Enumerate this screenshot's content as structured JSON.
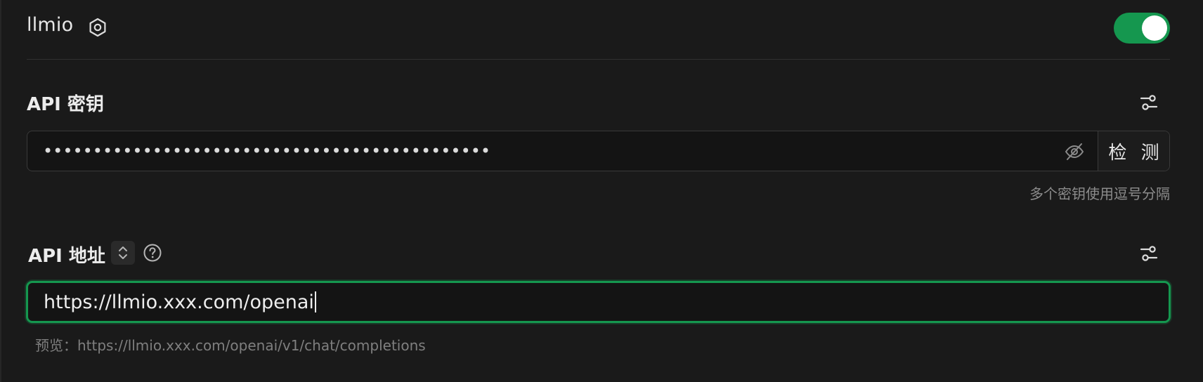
{
  "provider": {
    "name": "llmio",
    "enabled": true,
    "accent_color": "#15974f"
  },
  "icons": {
    "provider_settings": "hexagon-settings-icon",
    "key_settings": "sliders-icon",
    "visibility": "eye-off-icon",
    "address_settings": "sliders-icon",
    "address_switch": "chevron-up-down-icon",
    "help": "question-circle-icon"
  },
  "api_key": {
    "title": "API 密钥",
    "masked_value": "•••••••••••••••••••••••••••••••••••••••••••••",
    "check_button": "检 测",
    "hint": "多个密钥使用逗号分隔"
  },
  "api_address": {
    "title": "API 地址",
    "value": "https://llmio.xxx.com/openai",
    "preview_label": "预览：",
    "preview_value": "https://llmio.xxx.com/openai/v1/chat/completions"
  }
}
